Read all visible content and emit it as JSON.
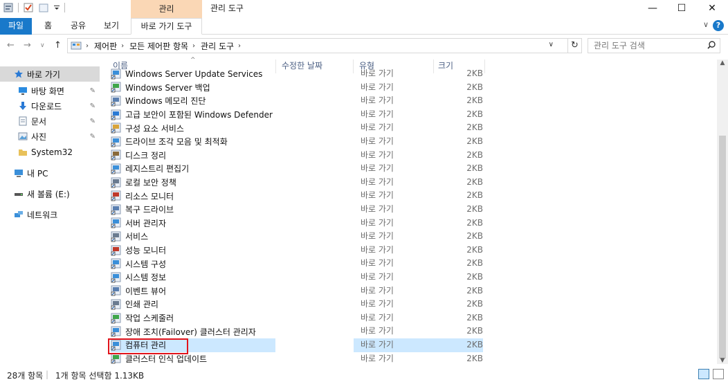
{
  "window": {
    "context_tab_top": "관리",
    "title": "관리 도구",
    "controls": {
      "minimize": "—",
      "maximize": "☐",
      "close": "✕"
    }
  },
  "ribbon": {
    "file": "파일",
    "tabs": [
      "홈",
      "공유",
      "보기"
    ],
    "context_tab": "바로 가기 도구",
    "help": "?",
    "collapse": "∨"
  },
  "nav": {
    "back": "←",
    "forward": "→",
    "recent": "∨",
    "up": "↑",
    "breadcrumb": [
      "제어판",
      "모든 제어판 항목",
      "관리 도구"
    ],
    "refresh": "↻",
    "search_placeholder": "관리 도구 검색"
  },
  "sidebar": {
    "items": [
      {
        "label": "바로 가기",
        "icon": "star-icon",
        "color": "#2a7ad5"
      },
      {
        "label": "바탕 화면",
        "icon": "desktop-icon",
        "color": "#2a8be0"
      },
      {
        "label": "다운로드",
        "icon": "download-icon",
        "color": "#2a7ad5"
      },
      {
        "label": "문서",
        "icon": "document-icon",
        "color": "#7a8ca3"
      },
      {
        "label": "사진",
        "icon": "picture-icon",
        "color": "#7a8ca3"
      },
      {
        "label": "System32",
        "icon": "folder-icon",
        "color": "#e8c15a"
      },
      {
        "label": "내 PC",
        "icon": "pc-icon",
        "color": "#3a8fd9"
      },
      {
        "label": "새 볼륨 (E:)",
        "icon": "drive-icon",
        "color": "#555555"
      },
      {
        "label": "네트워크",
        "icon": "network-icon",
        "color": "#3a8fd9"
      }
    ]
  },
  "columns": {
    "name": "이름",
    "modified": "수정한 날짜",
    "type": "유형",
    "size": "크기"
  },
  "files": [
    {
      "name": "Windows Server Update Services",
      "type": "바로 가기",
      "size": "2KB"
    },
    {
      "name": "Windows Server 백업",
      "type": "바로 가기",
      "size": "2KB"
    },
    {
      "name": "Windows 메모리 진단",
      "type": "바로 가기",
      "size": "2KB"
    },
    {
      "name": "고급 보안이 포함된 Windows Defender ...",
      "type": "바로 가기",
      "size": "2KB"
    },
    {
      "name": "구성 요소 서비스",
      "type": "바로 가기",
      "size": "2KB"
    },
    {
      "name": "드라이브 조각 모음 및 최적화",
      "type": "바로 가기",
      "size": "2KB"
    },
    {
      "name": "디스크 정리",
      "type": "바로 가기",
      "size": "2KB"
    },
    {
      "name": "레지스트리 편집기",
      "type": "바로 가기",
      "size": "2KB"
    },
    {
      "name": "로컬 보안 정책",
      "type": "바로 가기",
      "size": "2KB"
    },
    {
      "name": "리소스 모니터",
      "type": "바로 가기",
      "size": "2KB"
    },
    {
      "name": "복구 드라이브",
      "type": "바로 가기",
      "size": "2KB"
    },
    {
      "name": "서버 관리자",
      "type": "바로 가기",
      "size": "2KB"
    },
    {
      "name": "서비스",
      "type": "바로 가기",
      "size": "2KB"
    },
    {
      "name": "성능 모니터",
      "type": "바로 가기",
      "size": "2KB"
    },
    {
      "name": "시스템 구성",
      "type": "바로 가기",
      "size": "2KB"
    },
    {
      "name": "시스템 정보",
      "type": "바로 가기",
      "size": "2KB"
    },
    {
      "name": "이벤트 뷰어",
      "type": "바로 가기",
      "size": "2KB"
    },
    {
      "name": "인쇄 관리",
      "type": "바로 가기",
      "size": "2KB"
    },
    {
      "name": "작업 스케줄러",
      "type": "바로 가기",
      "size": "2KB"
    },
    {
      "name": "장애 조치(Failover) 클러스터 관리자",
      "type": "바로 가기",
      "size": "2KB"
    },
    {
      "name": "컴퓨터 관리",
      "type": "바로 가기",
      "size": "2KB",
      "selected": true
    },
    {
      "name": "클러스터 인식 업데이트",
      "type": "바로 가기",
      "size": "2KB"
    }
  ],
  "status": {
    "count": "28개 항목",
    "selection": "1개 항목 선택함 1.13KB"
  },
  "colors": {
    "accent": "#1979ca",
    "context_tab": "#fad7b5",
    "selection": "#cce8ff",
    "highlight_box": "#e1131b"
  }
}
